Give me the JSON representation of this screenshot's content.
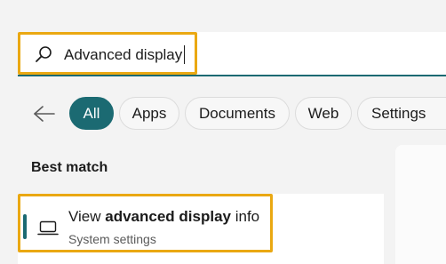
{
  "search": {
    "value": "Advanced display",
    "icon": "search-icon"
  },
  "filters": {
    "back_icon": "arrow-left-icon",
    "chips": [
      {
        "label": "All",
        "active": true
      },
      {
        "label": "Apps",
        "active": false
      },
      {
        "label": "Documents",
        "active": false
      },
      {
        "label": "Web",
        "active": false
      },
      {
        "label": "Settings",
        "active": false
      }
    ]
  },
  "best_match": {
    "heading": "Best match",
    "result": {
      "icon": "laptop-icon",
      "title_prefix": "View ",
      "title_bold": "advanced display",
      "title_suffix": " info",
      "subtitle": "System settings"
    }
  },
  "colors": {
    "accent": "#1b6a72",
    "highlight": "#eaa812",
    "background": "#f3f3f3"
  }
}
